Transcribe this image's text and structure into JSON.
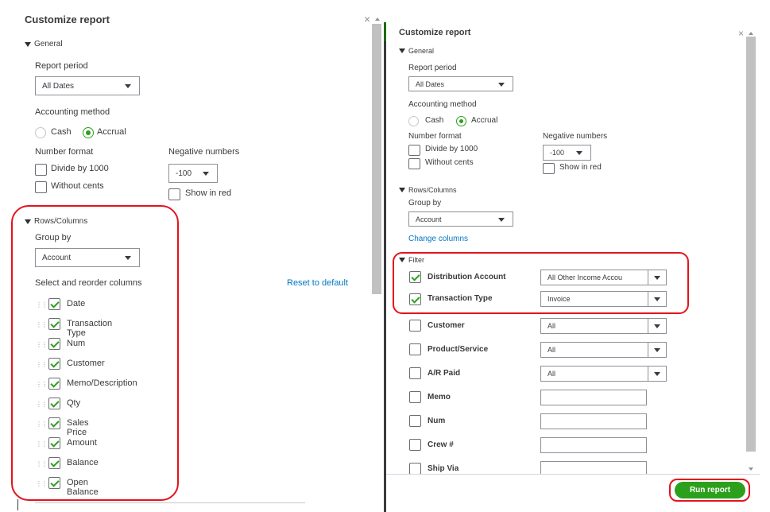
{
  "left": {
    "title": "Customize report",
    "close_glyph": "×",
    "general_label": "General",
    "report_period_label": "Report period",
    "report_period_value": "All Dates",
    "accounting_method_label": "Accounting method",
    "cash_label": "Cash",
    "accrual_label": "Accrual",
    "number_format_label": "Number format",
    "divide_label": "Divide by 1000",
    "without_cents_label": "Without cents",
    "negative_numbers_label": "Negative numbers",
    "negative_value": "-100",
    "show_in_red_label": "Show in red",
    "rows_columns_label": "Rows/Columns",
    "group_by_label": "Group by",
    "group_by_value": "Account",
    "select_columns_label": "Select and reorder columns",
    "reset_label": "Reset to default",
    "columns": [
      {
        "label": "Date"
      },
      {
        "label": "Transaction Type"
      },
      {
        "label": "Num"
      },
      {
        "label": "Customer"
      },
      {
        "label": "Memo/Description"
      },
      {
        "label": "Qty"
      },
      {
        "label": "Sales Price"
      },
      {
        "label": "Amount"
      },
      {
        "label": "Balance"
      },
      {
        "label": "Open Balance"
      }
    ]
  },
  "right": {
    "title": "Customize report",
    "close_glyph": "×",
    "general_label": "General",
    "report_period_label": "Report period",
    "report_period_value": "All Dates",
    "accounting_method_label": "Accounting method",
    "cash_label": "Cash",
    "accrual_label": "Accrual",
    "number_format_label": "Number format",
    "divide_label": "Divide by 1000",
    "without_cents_label": "Without cents",
    "negative_numbers_label": "Negative numbers",
    "negative_value": "-100",
    "show_in_red_label": "Show in red",
    "rows_columns_label": "Rows/Columns",
    "group_by_label": "Group by",
    "group_by_value": "Account",
    "change_columns_label": "Change columns",
    "filter_label": "Filter",
    "filters": [
      {
        "label": "Distribution Account",
        "checked": true,
        "value": "All Other Income Accou",
        "type": "select"
      },
      {
        "label": "Transaction Type",
        "checked": true,
        "value": "Invoice",
        "type": "select"
      },
      {
        "label": "Customer",
        "checked": false,
        "value": "All",
        "type": "select"
      },
      {
        "label": "Product/Service",
        "checked": false,
        "value": "All",
        "type": "select"
      },
      {
        "label": "A/R Paid",
        "checked": false,
        "value": "All",
        "type": "select"
      },
      {
        "label": "Memo",
        "checked": false,
        "value": "",
        "type": "input"
      },
      {
        "label": "Num",
        "checked": false,
        "value": "",
        "type": "input"
      },
      {
        "label": "Crew #",
        "checked": false,
        "value": "",
        "type": "input"
      },
      {
        "label": "Ship Via",
        "checked": false,
        "value": "",
        "type": "input"
      }
    ],
    "run_report_label": "Run report"
  },
  "colors": {
    "accent_green": "#2ca01c",
    "highlight_red": "#e3131d",
    "link_blue": "#0077c5"
  }
}
